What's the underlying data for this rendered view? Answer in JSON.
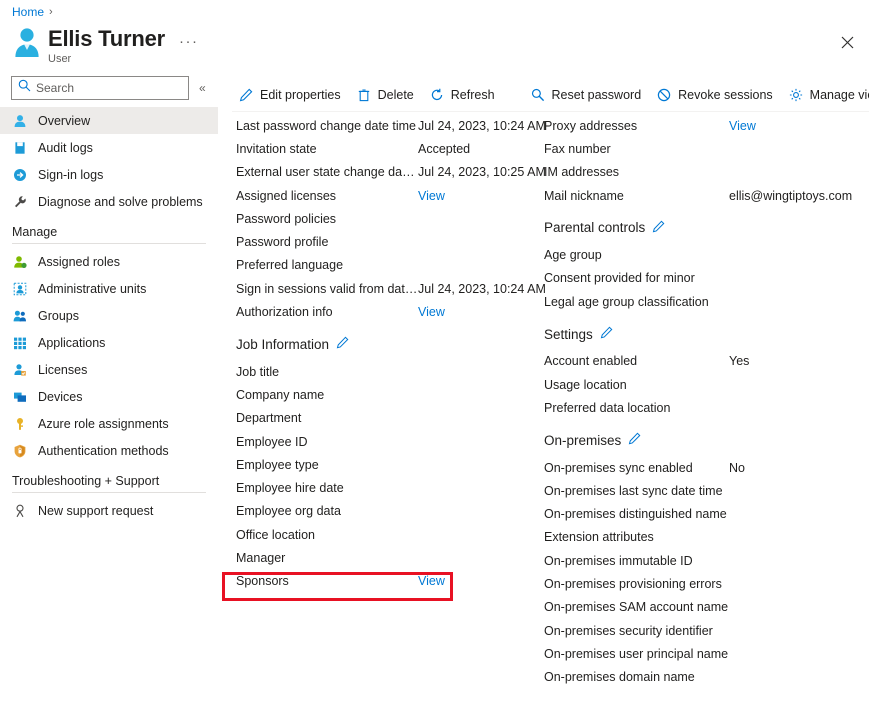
{
  "breadcrumb": {
    "home": "Home",
    "separator": "›"
  },
  "header": {
    "title": "Ellis Turner",
    "subtitle": "User",
    "ellipsis": "···",
    "avatar_icon": "user-avatar-icon",
    "close_icon": "close-icon"
  },
  "sidebar": {
    "search": {
      "placeholder": "Search",
      "value": "",
      "icon": "search-icon"
    },
    "collapse": {
      "icon": "chevron-double-left-icon",
      "glyph": "«"
    },
    "items": [
      {
        "label": "Overview",
        "icon": "user-icon",
        "selected": true
      },
      {
        "label": "Audit logs",
        "icon": "audit-log-icon",
        "selected": false
      },
      {
        "label": "Sign-in logs",
        "icon": "sign-in-icon",
        "selected": false
      },
      {
        "label": "Diagnose and solve problems",
        "icon": "wrench-icon",
        "selected": false
      }
    ],
    "group_manage": "Manage",
    "manage_items": [
      {
        "label": "Assigned roles",
        "icon": "assigned-roles-icon"
      },
      {
        "label": "Administrative units",
        "icon": "administrative-units-icon"
      },
      {
        "label": "Groups",
        "icon": "groups-icon"
      },
      {
        "label": "Applications",
        "icon": "applications-grid-icon"
      },
      {
        "label": "Licenses",
        "icon": "licenses-icon"
      },
      {
        "label": "Devices",
        "icon": "devices-icon"
      },
      {
        "label": "Azure role assignments",
        "icon": "key-icon"
      },
      {
        "label": "Authentication methods",
        "icon": "shield-lock-icon"
      }
    ],
    "group_support": "Troubleshooting + Support",
    "support_items": [
      {
        "label": "New support request",
        "icon": "support-person-icon"
      }
    ]
  },
  "toolbar": {
    "buttons": [
      {
        "label": "Edit properties",
        "icon": "pencil-icon"
      },
      {
        "label": "Delete",
        "icon": "trash-icon"
      },
      {
        "label": "Refresh",
        "icon": "refresh-icon"
      }
    ],
    "buttons2": [
      {
        "label": "Reset password",
        "icon": "magnifier-key-icon"
      },
      {
        "label": "Revoke sessions",
        "icon": "block-circle-icon"
      },
      {
        "label": "Manage view",
        "icon": "gear-icon"
      }
    ],
    "overflow": "···"
  },
  "left_column": {
    "properties": [
      {
        "label": "Last password change date time",
        "value": "Jul 24, 2023, 10:24 AM",
        "type": "text"
      },
      {
        "label": "Invitation state",
        "value": "Accepted",
        "type": "text"
      },
      {
        "label": "External user state change date ...",
        "value": "Jul 24, 2023, 10:25 AM",
        "type": "text"
      },
      {
        "label": "Assigned licenses",
        "value": "View",
        "type": "link"
      },
      {
        "label": "Password policies",
        "value": "",
        "type": "text"
      },
      {
        "label": "Password profile",
        "value": "",
        "type": "text"
      },
      {
        "label": "Preferred language",
        "value": "",
        "type": "text"
      },
      {
        "label": "Sign in sessions valid from date ...",
        "value": "Jul 24, 2023, 10:24 AM",
        "type": "text"
      },
      {
        "label": "Authorization info",
        "value": "View",
        "type": "link"
      }
    ],
    "job_section": {
      "title": "Job Information",
      "edit_icon": "pencil-icon"
    },
    "job_properties": [
      {
        "label": "Job title",
        "value": "",
        "type": "text"
      },
      {
        "label": "Company name",
        "value": "",
        "type": "text"
      },
      {
        "label": "Department",
        "value": "",
        "type": "text"
      },
      {
        "label": "Employee ID",
        "value": "",
        "type": "text"
      },
      {
        "label": "Employee type",
        "value": "",
        "type": "text"
      },
      {
        "label": "Employee hire date",
        "value": "",
        "type": "text"
      },
      {
        "label": "Employee org data",
        "value": "",
        "type": "text"
      },
      {
        "label": "Office location",
        "value": "",
        "type": "text"
      },
      {
        "label": "Manager",
        "value": "",
        "type": "text"
      },
      {
        "label": "Sponsors",
        "value": "View",
        "type": "link",
        "highlighted": true
      }
    ]
  },
  "right_column": {
    "properties": [
      {
        "label": "Proxy addresses",
        "value": "View",
        "type": "link"
      },
      {
        "label": "Fax number",
        "value": "",
        "type": "text"
      },
      {
        "label": "IM addresses",
        "value": "",
        "type": "text"
      },
      {
        "label": "Mail nickname",
        "value": "ellis@wingtiptoys.com",
        "type": "text"
      }
    ],
    "parental_section": {
      "title": "Parental controls",
      "edit_icon": "pencil-icon"
    },
    "parental_properties": [
      {
        "label": "Age group",
        "value": "",
        "type": "text"
      },
      {
        "label": "Consent provided for minor",
        "value": "",
        "type": "text"
      },
      {
        "label": "Legal age group classification",
        "value": "",
        "type": "text"
      }
    ],
    "settings_section": {
      "title": "Settings",
      "edit_icon": "pencil-icon"
    },
    "settings_properties": [
      {
        "label": "Account enabled",
        "value": "Yes",
        "type": "text"
      },
      {
        "label": "Usage location",
        "value": "",
        "type": "text"
      },
      {
        "label": "Preferred data location",
        "value": "",
        "type": "text"
      }
    ],
    "onprem_section": {
      "title": "On-premises",
      "edit_icon": "pencil-icon"
    },
    "onprem_properties": [
      {
        "label": "On-premises sync enabled",
        "value": "No",
        "type": "text"
      },
      {
        "label": "On-premises last sync date time",
        "value": "",
        "type": "text"
      },
      {
        "label": "On-premises distinguished name",
        "value": "",
        "type": "text"
      },
      {
        "label": "Extension attributes",
        "value": "",
        "type": "text"
      },
      {
        "label": "On-premises immutable ID",
        "value": "",
        "type": "text"
      },
      {
        "label": "On-premises provisioning errors",
        "value": "",
        "type": "text"
      },
      {
        "label": "On-premises SAM account name",
        "value": "",
        "type": "text"
      },
      {
        "label": "On-premises security identifier",
        "value": "",
        "type": "text"
      },
      {
        "label": "On-premises user principal name",
        "value": "",
        "type": "text"
      },
      {
        "label": "On-premises domain name",
        "value": "",
        "type": "text"
      }
    ]
  },
  "colors": {
    "accent_link": "#0078d4",
    "highlight_border": "#e81123",
    "selected_nav_bg": "#edebe9",
    "text_primary": "#201f1e",
    "text_secondary": "#605e5c"
  }
}
